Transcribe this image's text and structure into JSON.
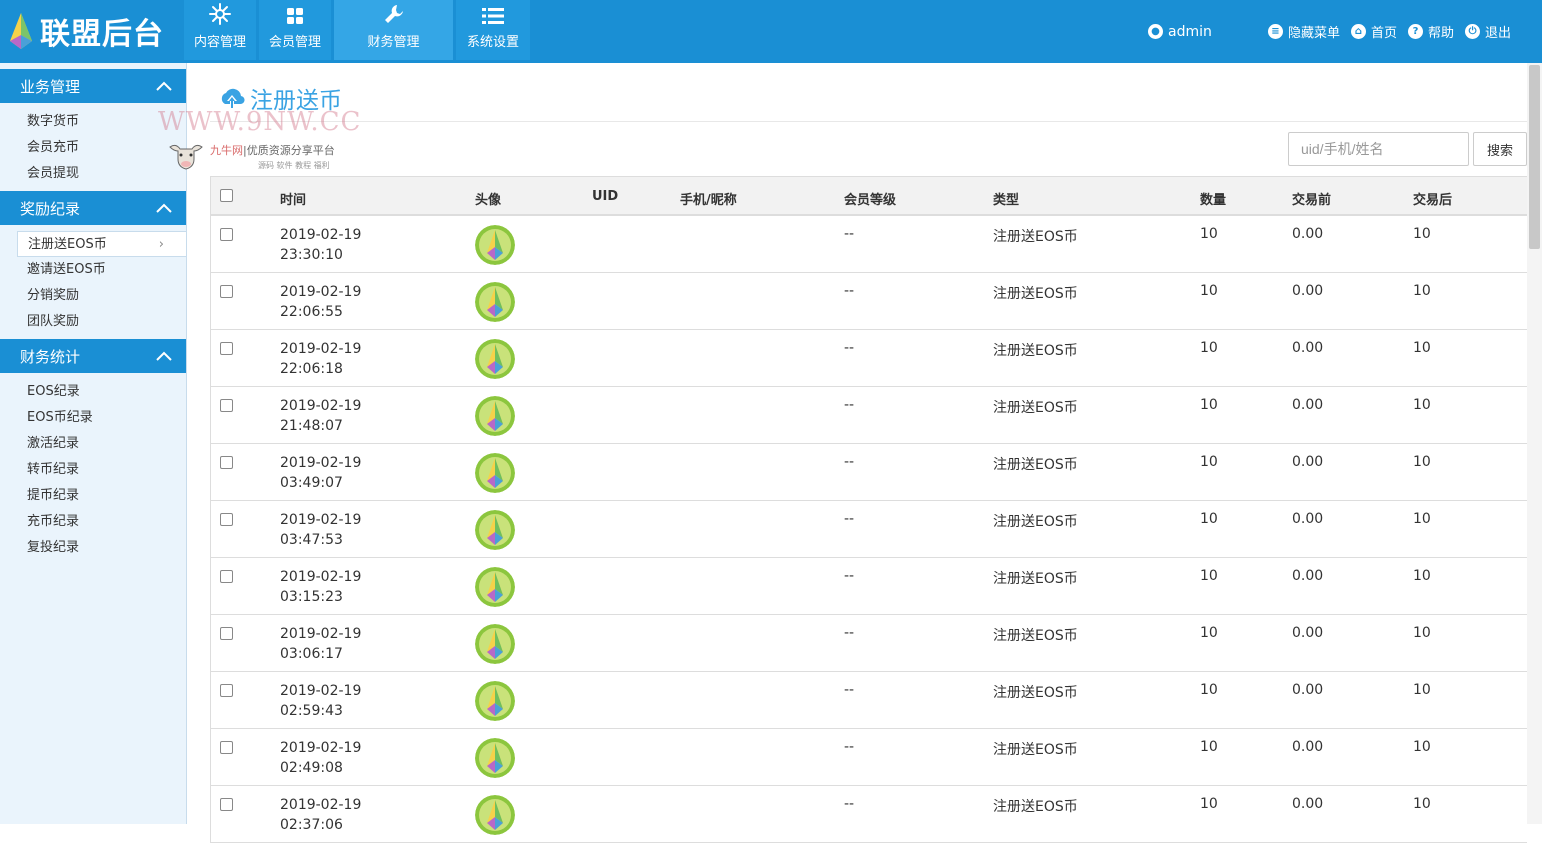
{
  "header": {
    "logo_text": "联盟后台",
    "nav": [
      {
        "label": "内容管理",
        "icon": "snowflake-icon"
      },
      {
        "label": "会员管理",
        "icon": "grid-icon"
      },
      {
        "label": "财务管理",
        "icon": "wrench-icon"
      },
      {
        "label": "系统设置",
        "icon": "list-icon"
      }
    ],
    "user": "admin",
    "links": [
      {
        "label": "隐藏菜单",
        "icon": "menu-icon"
      },
      {
        "label": "首页",
        "icon": "home-icon"
      },
      {
        "label": "帮助",
        "icon": "help-icon"
      },
      {
        "label": "退出",
        "icon": "logout-icon"
      }
    ]
  },
  "sidebar": {
    "sections": [
      {
        "title": "业务管理",
        "items": [
          "数字货币",
          "会员充币",
          "会员提现"
        ]
      },
      {
        "title": "奖励纪录",
        "items": [
          "注册送EOS币",
          "邀请送EOS币",
          "分销奖励",
          "团队奖励"
        ]
      },
      {
        "title": "财务统计",
        "items": [
          "EOS纪录",
          "EOS币纪录",
          "激活纪录",
          "转币纪录",
          "提币纪录",
          "充币纪录",
          "复投纪录"
        ]
      }
    ],
    "active_arrow": "›"
  },
  "page": {
    "title": "注册送币",
    "watermark": {
      "site": "WWW.9NW.CC",
      "brand": "九牛网",
      "slogan": "优质资源分享平台",
      "sub": "源码 软件 教程 福利"
    },
    "search": {
      "placeholder": "uid/手机/姓名",
      "button": "搜索"
    }
  },
  "table": {
    "columns": [
      "时间",
      "头像",
      "UID",
      "手机/昵称",
      "会员等级",
      "类型",
      "数量",
      "交易前",
      "交易后"
    ],
    "rows": [
      {
        "date": "2019-02-19",
        "time": "23:30:10",
        "uid": "",
        "phone": "",
        "level": "--",
        "type": "注册送EOS币",
        "qty": "10",
        "before": "0.00",
        "after": "10"
      },
      {
        "date": "2019-02-19",
        "time": "22:06:55",
        "uid": "",
        "phone": "",
        "level": "--",
        "type": "注册送EOS币",
        "qty": "10",
        "before": "0.00",
        "after": "10"
      },
      {
        "date": "2019-02-19",
        "time": "22:06:18",
        "uid": "",
        "phone": "",
        "level": "--",
        "type": "注册送EOS币",
        "qty": "10",
        "before": "0.00",
        "after": "10"
      },
      {
        "date": "2019-02-19",
        "time": "21:48:07",
        "uid": "",
        "phone": "",
        "level": "--",
        "type": "注册送EOS币",
        "qty": "10",
        "before": "0.00",
        "after": "10"
      },
      {
        "date": "2019-02-19",
        "time": "03:49:07",
        "uid": "",
        "phone": "",
        "level": "--",
        "type": "注册送EOS币",
        "qty": "10",
        "before": "0.00",
        "after": "10"
      },
      {
        "date": "2019-02-19",
        "time": "03:47:53",
        "uid": "",
        "phone": "",
        "level": "--",
        "type": "注册送EOS币",
        "qty": "10",
        "before": "0.00",
        "after": "10"
      },
      {
        "date": "2019-02-19",
        "time": "03:15:23",
        "uid": "",
        "phone": "",
        "level": "--",
        "type": "注册送EOS币",
        "qty": "10",
        "before": "0.00",
        "after": "10"
      },
      {
        "date": "2019-02-19",
        "time": "03:06:17",
        "uid": "",
        "phone": "",
        "level": "--",
        "type": "注册送EOS币",
        "qty": "10",
        "before": "0.00",
        "after": "10"
      },
      {
        "date": "2019-02-19",
        "time": "02:59:43",
        "uid": "",
        "phone": "",
        "level": "--",
        "type": "注册送EOS币",
        "qty": "10",
        "before": "0.00",
        "after": "10"
      },
      {
        "date": "2019-02-19",
        "time": "02:49:08",
        "uid": "",
        "phone": "",
        "level": "--",
        "type": "注册送EOS币",
        "qty": "10",
        "before": "0.00",
        "after": "10"
      },
      {
        "date": "2019-02-19",
        "time": "02:37:06",
        "uid": "",
        "phone": "",
        "level": "--",
        "type": "注册送EOS币",
        "qty": "10",
        "before": "0.00",
        "after": "10"
      }
    ]
  },
  "colors": {
    "primary": "#1a8fd4",
    "nav_active": "#34a6e6",
    "sidebar_bg": "#eaf4fc",
    "title": "#3aa3e3"
  }
}
